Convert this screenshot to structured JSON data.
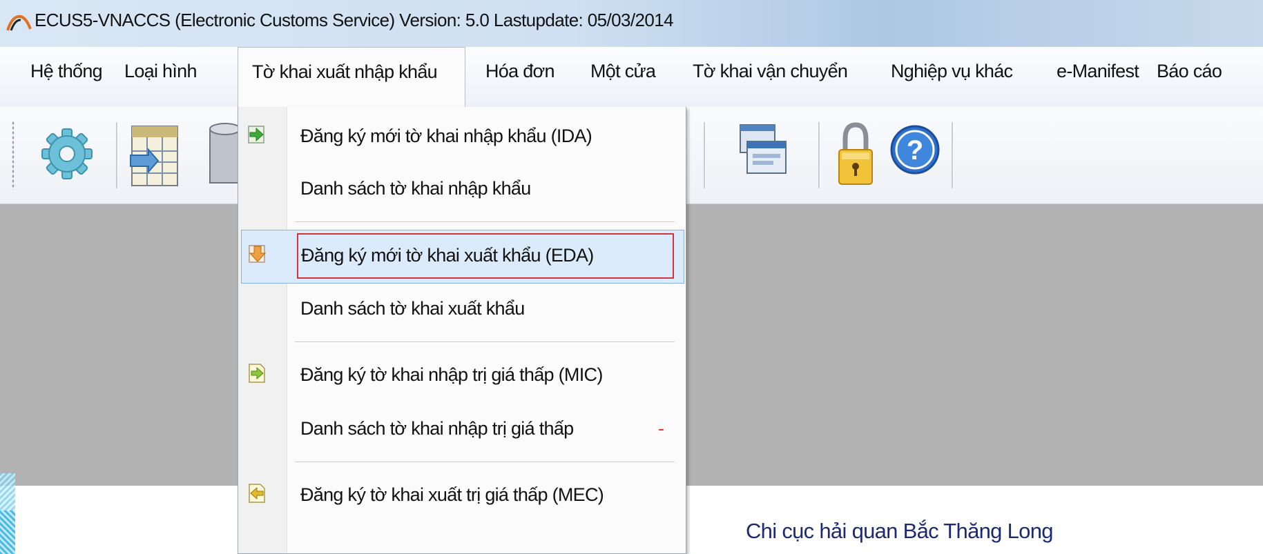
{
  "window": {
    "title": "ECUS5-VNACCS (Electronic Customs Service) Version: 5.0 Lastupdate: 05/03/2014"
  },
  "menubar": {
    "items": [
      {
        "label": "Hệ thống"
      },
      {
        "label": "Loại hình"
      },
      {
        "label": "Tờ khai xuất nhập khẩu",
        "open": true
      },
      {
        "label": "Hóa đơn"
      },
      {
        "label": "Một cửa"
      },
      {
        "label": "Tờ khai vận chuyển"
      },
      {
        "label": "Nghiệp vụ khác"
      },
      {
        "label": "e-Manifest"
      },
      {
        "label": "Báo cáo"
      }
    ]
  },
  "toolbar": {
    "buttons": [
      {
        "icon": "gear-icon"
      },
      {
        "icon": "table-import-icon"
      },
      {
        "icon": "database-icon"
      },
      {
        "icon": "windows-icon"
      },
      {
        "icon": "lock-icon"
      },
      {
        "icon": "help-icon"
      }
    ]
  },
  "dropdown": {
    "items": [
      {
        "label": "Đăng ký mới tờ khai nhập khẩu (IDA)",
        "icon": "import-arrow-icon"
      },
      {
        "label": "Danh sách tờ khai nhập khẩu"
      },
      {
        "label": "Đăng ký mới tờ khai xuất khẩu (EDA)",
        "icon": "export-arrow-icon",
        "highlighted": true
      },
      {
        "label": "Danh sách tờ khai xuất khẩu"
      },
      {
        "label": "Đăng ký tờ khai nhập trị giá thấp (MIC)",
        "icon": "doc-import-icon"
      },
      {
        "label": "Danh sách tờ khai nhập trị giá thấp",
        "marker": "-"
      },
      {
        "label": "Đăng ký tờ khai xuất trị giá thấp (MEC)",
        "icon": "doc-export-icon"
      }
    ]
  },
  "status": {
    "text": "Chi cục hải quan Bắc Thăng Long"
  },
  "colors": {
    "menu_highlight": "#dcebfc",
    "highlight_border": "#d0333e",
    "client_background": "#b2b2b2",
    "status_text": "#1b2a72"
  }
}
